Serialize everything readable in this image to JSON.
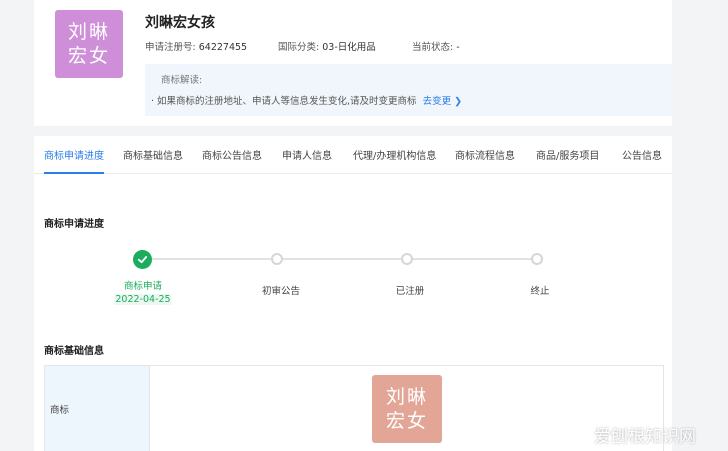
{
  "trademark": {
    "logo_text": "刘晽\n宏女",
    "name": "刘晽宏女孩",
    "reg_label": "申请注册号:",
    "reg_number": "64227455",
    "class_label": "国际分类:",
    "class_value": "03-日化用品",
    "status_label": "当前状态:",
    "status_value": "-"
  },
  "note": {
    "title": "商标解读:",
    "text": "· 如果商标的注册地址、申请人等信息发生变化,请及时变更商标",
    "link": "去变更 ❯"
  },
  "tabs": [
    {
      "label": "商标申请进度"
    },
    {
      "label": "商标基础信息"
    },
    {
      "label": "商标公告信息"
    },
    {
      "label": "申请人信息"
    },
    {
      "label": "代理/办理机构信息"
    },
    {
      "label": "商标流程信息"
    },
    {
      "label": "商品/服务项目"
    },
    {
      "label": "公告信息"
    }
  ],
  "progress": {
    "title": "商标申请进度",
    "steps": [
      {
        "label": "商标申请",
        "date": "2022-04-25",
        "done": true
      },
      {
        "label": "初审公告",
        "done": false
      },
      {
        "label": "已注册",
        "done": false
      },
      {
        "label": "终止",
        "done": false
      }
    ]
  },
  "basic_info": {
    "title": "商标基础信息",
    "row_label": "商标",
    "image_text": "刘晽\n宏女"
  },
  "watermark": "爱刨根知识网",
  "colors": {
    "accent": "#2b7de9",
    "success": "#1aad5d",
    "logo_bg": "#cf8ed8",
    "image_bg": "#e3a696"
  }
}
